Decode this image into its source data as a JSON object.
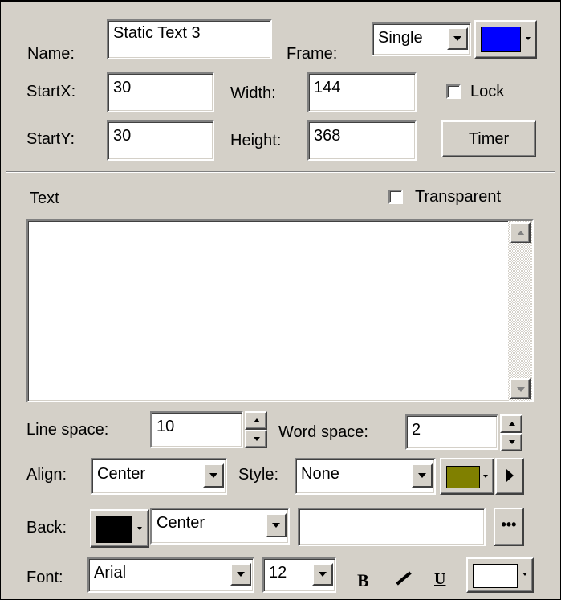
{
  "properties": {
    "name_label": "Name:",
    "name_value": "Static Text 3",
    "frame_label": "Frame:",
    "frame_value": "Single",
    "frame_color": "#0000ff",
    "startx_label": "StartX:",
    "startx_value": "30",
    "width_label": "Width:",
    "width_value": "144",
    "lock_label": "Lock",
    "lock_checked": false,
    "starty_label": "StartY:",
    "starty_value": "30",
    "height_label": "Height:",
    "height_value": "368",
    "timer_label": "Timer"
  },
  "text_section": {
    "text_label": "Text",
    "transparent_label": "Transparent",
    "transparent_checked": false,
    "text_value": ""
  },
  "formatting": {
    "line_space_label": "Line space:",
    "line_space_value": "10",
    "word_space_label": "Word space:",
    "word_space_value": "2",
    "align_label": "Align:",
    "align_value": "Center",
    "style_label": "Style:",
    "style_value": "None",
    "style_color": "#808000",
    "back_label": "Back:",
    "back_color": "#000000",
    "back_align_value": "Center",
    "back_image_value": "",
    "font_label": "Font:",
    "font_value": "Arial",
    "font_size_value": "12",
    "bold_label": "B",
    "italic_label": "I",
    "underline_label": "U",
    "font_color": "#ffffff"
  }
}
